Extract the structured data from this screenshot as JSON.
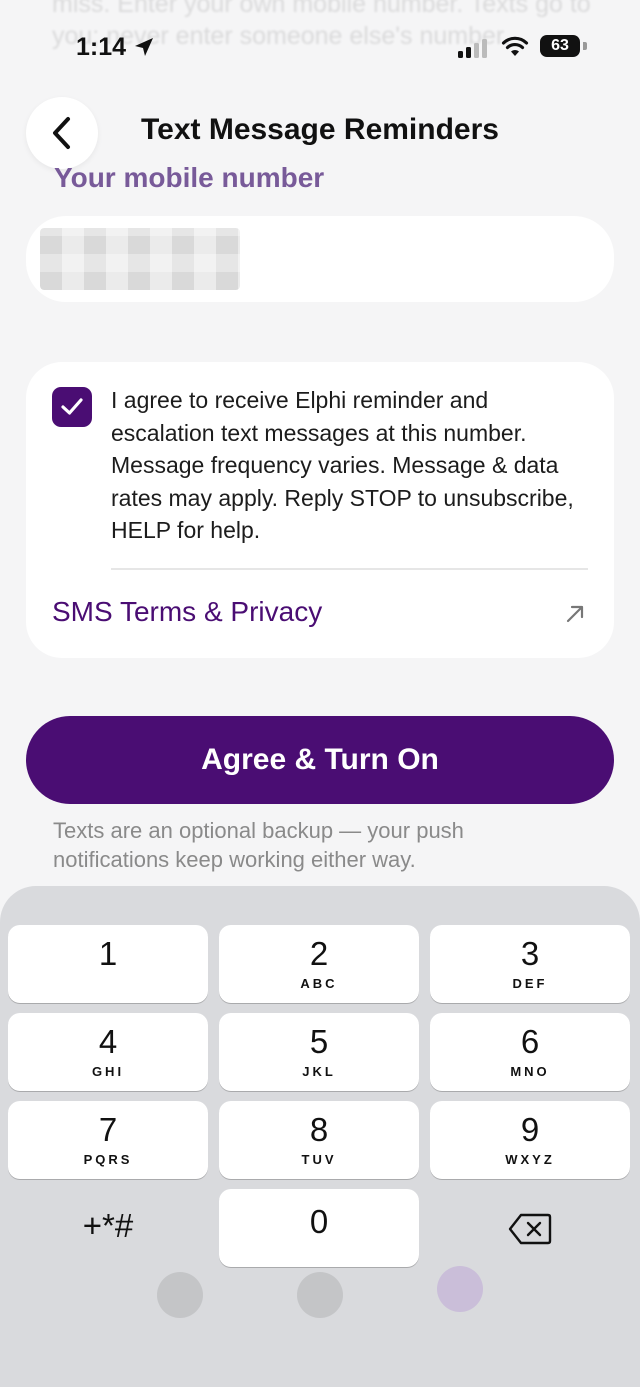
{
  "background_text": "miss. Enter your own mobile number. Texts go to you; never enter someone else's number.",
  "status_bar": {
    "time": "1:14",
    "battery": "63"
  },
  "header": {
    "title": "Text Message Reminders"
  },
  "phone_section": {
    "label": "Your mobile number",
    "value": ""
  },
  "consent": {
    "checked": true,
    "text": "I agree to receive Elphi reminder and escalation text messages at this number. Message frequency varies. Message & data rates may apply. Reply STOP to unsubscribe, HELP for help.",
    "terms_link": "SMS Terms & Privacy"
  },
  "primary_button": {
    "label": "Agree & Turn On"
  },
  "footnote": "Texts are an optional backup — your push notifications keep working either way.",
  "keypad": {
    "keys": [
      {
        "digit": "1",
        "letters": ""
      },
      {
        "digit": "2",
        "letters": "ABC"
      },
      {
        "digit": "3",
        "letters": "DEF"
      },
      {
        "digit": "4",
        "letters": "GHI"
      },
      {
        "digit": "5",
        "letters": "JKL"
      },
      {
        "digit": "6",
        "letters": "MNO"
      },
      {
        "digit": "7",
        "letters": "PQRS"
      },
      {
        "digit": "8",
        "letters": "TUV"
      },
      {
        "digit": "9",
        "letters": "WXYZ"
      }
    ],
    "symbols_key": "+*#",
    "zero_key": "0",
    "delete_icon": "backspace-icon"
  },
  "colors": {
    "accent": "#4a0d73",
    "label_purple": "#6b4a90",
    "background": "#f5f5f6",
    "keypad_bg": "#d9dadd"
  }
}
